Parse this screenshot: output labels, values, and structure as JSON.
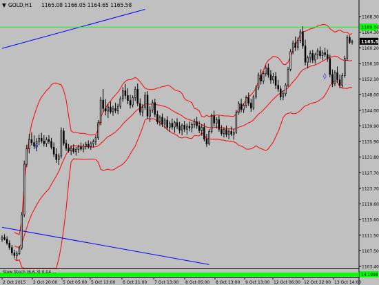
{
  "header": {
    "arrow": "▼",
    "symbol": "GOLD,H1",
    "ohlc": "1165.08 1166.05 1164.65 1165.58"
  },
  "indicator_label": "Slow Stoch (6,6,3) 0.04 ...",
  "colors": {
    "background": "#c0c0c0",
    "candle": "#000000",
    "bollinger": "#ff0000",
    "trendline": "#0000ff",
    "resistance_line": "#00ff00",
    "oscillator": "#00ff00",
    "last_price_label": "#000000",
    "marker": "#0000ff"
  },
  "chart_data": {
    "type": "candlestick",
    "symbol": "GOLD",
    "timeframe": "H1",
    "ylim": [
      1103.4,
      1172.4
    ],
    "ytick_labels": [
      "1168.30",
      "1164.30",
      "1160.20",
      "1156.10",
      "1152.10",
      "1148.00",
      "1144.00",
      "1139.90",
      "1135.90",
      "1131.80",
      "1127.70",
      "1123.70",
      "1119.60",
      "1115.60",
      "1111.50",
      "1107.50",
      "1103.40"
    ],
    "xtick_labels": [
      "2 Oct 2015",
      "2 Oct 20:00",
      "5 Oct 05:00",
      "5 Oct 13:00",
      "6 Oct 21:00",
      "7 Oct 13:00",
      "8 Oct 05:00",
      "8 Oct 13:00",
      "9 Oct 13:00",
      "12 Oct 06:00",
      "12 Oct 22:00",
      "13 Oct 14:00"
    ],
    "resistance_level": 1169.5,
    "resistance_label": "1169.50",
    "last_price": 1165.58,
    "last_price_label": "1165.58",
    "oscillator_label": "Slow Stoch (6,6,3) 0.04 ...",
    "oscillator_value_label": "14.1998",
    "bollinger_period": 20,
    "marker_glyph": "◊",
    "markers": [
      {
        "candle": 14,
        "price": 1136.7
      },
      {
        "candle": 131,
        "price": 1156.0
      }
    ],
    "trendlines": [
      {
        "from": {
          "candle": 0,
          "price": 1163.6
        },
        "to": {
          "candle": 58,
          "price": 1174.4
        }
      },
      {
        "from": {
          "candle": 0,
          "price": 1114.2
        },
        "to": {
          "candle": 84,
          "price": 1103.9
        }
      }
    ],
    "candles": [
      {
        "o": 1110.8,
        "h": 1112.0,
        "l": 1110.2,
        "c": 1111.4
      },
      {
        "o": 1111.4,
        "h": 1112.3,
        "l": 1110.6,
        "c": 1110.9
      },
      {
        "o": 1110.9,
        "h": 1111.7,
        "l": 1109.3,
        "c": 1109.8
      },
      {
        "o": 1109.8,
        "h": 1110.6,
        "l": 1108.0,
        "c": 1108.6
      },
      {
        "o": 1108.6,
        "h": 1109.3,
        "l": 1106.4,
        "c": 1107.1
      },
      {
        "o": 1107.1,
        "h": 1108.0,
        "l": 1105.6,
        "c": 1106.4
      },
      {
        "o": 1106.4,
        "h": 1107.6,
        "l": 1105.2,
        "c": 1106.9
      },
      {
        "o": 1106.9,
        "h": 1109.0,
        "l": 1106.5,
        "c": 1108.5
      },
      {
        "o": 1108.5,
        "h": 1118.4,
        "l": 1108.0,
        "c": 1117.6
      },
      {
        "o": 1117.6,
        "h": 1132.6,
        "l": 1117.0,
        "c": 1131.6
      },
      {
        "o": 1131.6,
        "h": 1137.0,
        "l": 1130.8,
        "c": 1135.9
      },
      {
        "o": 1135.9,
        "h": 1140.0,
        "l": 1134.6,
        "c": 1138.4
      },
      {
        "o": 1138.4,
        "h": 1140.4,
        "l": 1136.8,
        "c": 1137.6
      },
      {
        "o": 1137.6,
        "h": 1139.6,
        "l": 1135.8,
        "c": 1136.6
      },
      {
        "o": 1136.6,
        "h": 1138.8,
        "l": 1135.2,
        "c": 1137.9
      },
      {
        "o": 1137.9,
        "h": 1139.8,
        "l": 1136.9,
        "c": 1138.8
      },
      {
        "o": 1138.8,
        "h": 1140.3,
        "l": 1137.4,
        "c": 1138.0
      },
      {
        "o": 1138.0,
        "h": 1139.6,
        "l": 1136.5,
        "c": 1137.3
      },
      {
        "o": 1137.3,
        "h": 1139.1,
        "l": 1136.4,
        "c": 1138.4
      },
      {
        "o": 1138.4,
        "h": 1139.6,
        "l": 1137.2,
        "c": 1137.9
      },
      {
        "o": 1137.9,
        "h": 1138.9,
        "l": 1135.7,
        "c": 1136.3
      },
      {
        "o": 1136.3,
        "h": 1137.6,
        "l": 1133.6,
        "c": 1134.4
      },
      {
        "o": 1134.4,
        "h": 1136.0,
        "l": 1132.0,
        "c": 1132.9
      },
      {
        "o": 1132.9,
        "h": 1134.6,
        "l": 1131.4,
        "c": 1133.9
      },
      {
        "o": 1133.9,
        "h": 1141.8,
        "l": 1133.2,
        "c": 1140.8
      },
      {
        "o": 1140.8,
        "h": 1141.6,
        "l": 1136.7,
        "c": 1137.4
      },
      {
        "o": 1137.4,
        "h": 1138.4,
        "l": 1135.3,
        "c": 1136.0
      },
      {
        "o": 1136.0,
        "h": 1137.2,
        "l": 1134.8,
        "c": 1135.3
      },
      {
        "o": 1135.3,
        "h": 1136.8,
        "l": 1134.1,
        "c": 1136.0
      },
      {
        "o": 1136.0,
        "h": 1137.1,
        "l": 1134.6,
        "c": 1135.1
      },
      {
        "o": 1135.1,
        "h": 1136.4,
        "l": 1134.0,
        "c": 1135.7
      },
      {
        "o": 1135.7,
        "h": 1137.0,
        "l": 1134.7,
        "c": 1136.4
      },
      {
        "o": 1136.4,
        "h": 1137.6,
        "l": 1135.3,
        "c": 1135.8
      },
      {
        "o": 1135.8,
        "h": 1137.3,
        "l": 1134.9,
        "c": 1136.6
      },
      {
        "o": 1136.6,
        "h": 1137.8,
        "l": 1135.7,
        "c": 1137.1
      },
      {
        "o": 1137.1,
        "h": 1138.2,
        "l": 1135.9,
        "c": 1136.5
      },
      {
        "o": 1136.5,
        "h": 1137.9,
        "l": 1135.6,
        "c": 1137.3
      },
      {
        "o": 1137.3,
        "h": 1138.5,
        "l": 1136.2,
        "c": 1137.8
      },
      {
        "o": 1137.8,
        "h": 1139.6,
        "l": 1136.9,
        "c": 1138.9
      },
      {
        "o": 1138.9,
        "h": 1143.8,
        "l": 1138.3,
        "c": 1143.1
      },
      {
        "o": 1143.1,
        "h": 1150.2,
        "l": 1142.4,
        "c": 1149.3
      },
      {
        "o": 1149.3,
        "h": 1152.4,
        "l": 1146.0,
        "c": 1147.0
      },
      {
        "o": 1147.0,
        "h": 1149.6,
        "l": 1145.1,
        "c": 1146.3
      },
      {
        "o": 1146.3,
        "h": 1148.2,
        "l": 1144.4,
        "c": 1147.4
      },
      {
        "o": 1147.4,
        "h": 1148.9,
        "l": 1145.6,
        "c": 1146.1
      },
      {
        "o": 1146.1,
        "h": 1147.8,
        "l": 1145.0,
        "c": 1147.0
      },
      {
        "o": 1147.0,
        "h": 1148.6,
        "l": 1145.7,
        "c": 1146.4
      },
      {
        "o": 1146.4,
        "h": 1148.3,
        "l": 1145.4,
        "c": 1147.6
      },
      {
        "o": 1147.6,
        "h": 1150.4,
        "l": 1146.9,
        "c": 1149.7
      },
      {
        "o": 1149.7,
        "h": 1152.9,
        "l": 1148.9,
        "c": 1151.9
      },
      {
        "o": 1151.9,
        "h": 1153.8,
        "l": 1149.6,
        "c": 1150.6
      },
      {
        "o": 1150.6,
        "h": 1152.6,
        "l": 1148.2,
        "c": 1149.2
      },
      {
        "o": 1149.2,
        "h": 1150.8,
        "l": 1147.0,
        "c": 1148.0
      },
      {
        "o": 1148.0,
        "h": 1150.6,
        "l": 1147.3,
        "c": 1150.0
      },
      {
        "o": 1150.0,
        "h": 1153.1,
        "l": 1149.1,
        "c": 1152.3
      },
      {
        "o": 1152.3,
        "h": 1153.9,
        "l": 1147.6,
        "c": 1148.4
      },
      {
        "o": 1148.4,
        "h": 1149.8,
        "l": 1145.1,
        "c": 1146.0
      },
      {
        "o": 1146.0,
        "h": 1148.2,
        "l": 1144.8,
        "c": 1147.3
      },
      {
        "o": 1147.3,
        "h": 1151.6,
        "l": 1146.6,
        "c": 1150.7
      },
      {
        "o": 1150.7,
        "h": 1151.8,
        "l": 1144.1,
        "c": 1144.9
      },
      {
        "o": 1144.9,
        "h": 1147.6,
        "l": 1143.3,
        "c": 1146.6
      },
      {
        "o": 1146.6,
        "h": 1149.4,
        "l": 1145.8,
        "c": 1148.6
      },
      {
        "o": 1148.6,
        "h": 1149.7,
        "l": 1144.6,
        "c": 1145.4
      },
      {
        "o": 1145.4,
        "h": 1146.4,
        "l": 1142.6,
        "c": 1143.3
      },
      {
        "o": 1143.3,
        "h": 1145.1,
        "l": 1142.2,
        "c": 1144.6
      },
      {
        "o": 1144.6,
        "h": 1145.6,
        "l": 1141.9,
        "c": 1142.7
      },
      {
        "o": 1142.7,
        "h": 1144.4,
        "l": 1141.5,
        "c": 1143.8
      },
      {
        "o": 1143.8,
        "h": 1144.9,
        "l": 1141.0,
        "c": 1141.8
      },
      {
        "o": 1141.8,
        "h": 1143.5,
        "l": 1140.6,
        "c": 1142.9
      },
      {
        "o": 1142.9,
        "h": 1144.2,
        "l": 1141.2,
        "c": 1141.9
      },
      {
        "o": 1141.9,
        "h": 1143.6,
        "l": 1140.3,
        "c": 1143.1
      },
      {
        "o": 1143.1,
        "h": 1144.3,
        "l": 1141.3,
        "c": 1142.1
      },
      {
        "o": 1142.1,
        "h": 1143.3,
        "l": 1140.1,
        "c": 1141.0
      },
      {
        "o": 1141.0,
        "h": 1142.9,
        "l": 1139.6,
        "c": 1142.4
      },
      {
        "o": 1142.4,
        "h": 1143.6,
        "l": 1140.5,
        "c": 1141.3
      },
      {
        "o": 1141.3,
        "h": 1142.8,
        "l": 1139.8,
        "c": 1142.1
      },
      {
        "o": 1142.1,
        "h": 1143.4,
        "l": 1140.7,
        "c": 1141.6
      },
      {
        "o": 1141.6,
        "h": 1143.2,
        "l": 1140.4,
        "c": 1142.6
      },
      {
        "o": 1142.6,
        "h": 1144.2,
        "l": 1141.6,
        "c": 1143.4
      },
      {
        "o": 1143.4,
        "h": 1144.7,
        "l": 1141.4,
        "c": 1142.2
      },
      {
        "o": 1142.2,
        "h": 1143.5,
        "l": 1140.2,
        "c": 1140.9
      },
      {
        "o": 1140.9,
        "h": 1142.6,
        "l": 1139.5,
        "c": 1141.8
      },
      {
        "o": 1141.8,
        "h": 1143.0,
        "l": 1137.9,
        "c": 1138.6
      },
      {
        "o": 1138.6,
        "h": 1140.0,
        "l": 1136.4,
        "c": 1137.2
      },
      {
        "o": 1137.2,
        "h": 1141.3,
        "l": 1136.8,
        "c": 1140.7
      },
      {
        "o": 1140.7,
        "h": 1145.6,
        "l": 1140.1,
        "c": 1144.9
      },
      {
        "o": 1144.9,
        "h": 1146.4,
        "l": 1142.0,
        "c": 1143.0
      },
      {
        "o": 1143.0,
        "h": 1144.6,
        "l": 1141.5,
        "c": 1143.9
      },
      {
        "o": 1143.9,
        "h": 1145.0,
        "l": 1140.6,
        "c": 1141.3
      },
      {
        "o": 1141.3,
        "h": 1142.4,
        "l": 1139.5,
        "c": 1140.1
      },
      {
        "o": 1140.1,
        "h": 1141.8,
        "l": 1139.0,
        "c": 1141.2
      },
      {
        "o": 1141.2,
        "h": 1142.3,
        "l": 1139.1,
        "c": 1139.8
      },
      {
        "o": 1139.8,
        "h": 1141.3,
        "l": 1138.6,
        "c": 1140.7
      },
      {
        "o": 1140.7,
        "h": 1142.0,
        "l": 1139.4,
        "c": 1139.9
      },
      {
        "o": 1139.9,
        "h": 1141.3,
        "l": 1138.4,
        "c": 1140.5
      },
      {
        "o": 1140.5,
        "h": 1146.6,
        "l": 1140.0,
        "c": 1145.9
      },
      {
        "o": 1145.9,
        "h": 1149.0,
        "l": 1145.3,
        "c": 1148.3
      },
      {
        "o": 1148.3,
        "h": 1149.7,
        "l": 1145.9,
        "c": 1146.7
      },
      {
        "o": 1146.7,
        "h": 1148.4,
        "l": 1145.8,
        "c": 1147.9
      },
      {
        "o": 1147.9,
        "h": 1150.6,
        "l": 1147.2,
        "c": 1150.0
      },
      {
        "o": 1150.0,
        "h": 1151.4,
        "l": 1147.7,
        "c": 1148.5
      },
      {
        "o": 1148.5,
        "h": 1149.6,
        "l": 1146.1,
        "c": 1147.1
      },
      {
        "o": 1147.1,
        "h": 1150.8,
        "l": 1146.6,
        "c": 1150.2
      },
      {
        "o": 1150.2,
        "h": 1153.4,
        "l": 1149.6,
        "c": 1152.7
      },
      {
        "o": 1152.7,
        "h": 1156.9,
        "l": 1152.1,
        "c": 1156.2
      },
      {
        "o": 1156.2,
        "h": 1157.8,
        "l": 1153.6,
        "c": 1154.6
      },
      {
        "o": 1154.6,
        "h": 1157.3,
        "l": 1153.8,
        "c": 1156.7
      },
      {
        "o": 1156.7,
        "h": 1158.9,
        "l": 1155.9,
        "c": 1158.2
      },
      {
        "o": 1158.2,
        "h": 1159.4,
        "l": 1155.5,
        "c": 1156.3
      },
      {
        "o": 1156.3,
        "h": 1157.6,
        "l": 1153.8,
        "c": 1154.9
      },
      {
        "o": 1154.9,
        "h": 1156.8,
        "l": 1153.9,
        "c": 1155.9
      },
      {
        "o": 1155.9,
        "h": 1157.1,
        "l": 1152.4,
        "c": 1153.4
      },
      {
        "o": 1153.4,
        "h": 1154.9,
        "l": 1151.6,
        "c": 1152.4
      },
      {
        "o": 1152.4,
        "h": 1153.3,
        "l": 1149.3,
        "c": 1150.2
      },
      {
        "o": 1150.2,
        "h": 1152.0,
        "l": 1149.3,
        "c": 1151.1
      },
      {
        "o": 1151.1,
        "h": 1154.0,
        "l": 1150.4,
        "c": 1153.5
      },
      {
        "o": 1153.5,
        "h": 1158.5,
        "l": 1153.0,
        "c": 1157.8
      },
      {
        "o": 1157.8,
        "h": 1163.4,
        "l": 1157.3,
        "c": 1162.7
      },
      {
        "o": 1162.7,
        "h": 1165.8,
        "l": 1162.0,
        "c": 1165.1
      },
      {
        "o": 1165.1,
        "h": 1166.9,
        "l": 1162.9,
        "c": 1163.9
      },
      {
        "o": 1163.9,
        "h": 1166.6,
        "l": 1163.1,
        "c": 1165.8
      },
      {
        "o": 1165.8,
        "h": 1168.9,
        "l": 1165.1,
        "c": 1168.2
      },
      {
        "o": 1168.2,
        "h": 1169.7,
        "l": 1163.5,
        "c": 1164.3
      },
      {
        "o": 1164.3,
        "h": 1166.0,
        "l": 1158.9,
        "c": 1159.8
      },
      {
        "o": 1159.8,
        "h": 1161.6,
        "l": 1158.1,
        "c": 1161.0
      },
      {
        "o": 1161.0,
        "h": 1163.0,
        "l": 1159.7,
        "c": 1162.2
      },
      {
        "o": 1162.2,
        "h": 1163.2,
        "l": 1159.6,
        "c": 1160.4
      },
      {
        "o": 1160.4,
        "h": 1162.4,
        "l": 1159.4,
        "c": 1161.8
      },
      {
        "o": 1161.8,
        "h": 1163.6,
        "l": 1160.6,
        "c": 1162.9
      },
      {
        "o": 1162.9,
        "h": 1164.1,
        "l": 1160.8,
        "c": 1161.6
      },
      {
        "o": 1161.6,
        "h": 1163.1,
        "l": 1160.3,
        "c": 1162.4
      },
      {
        "o": 1162.4,
        "h": 1163.8,
        "l": 1161.1,
        "c": 1161.9
      },
      {
        "o": 1161.9,
        "h": 1163.3,
        "l": 1159.9,
        "c": 1160.8
      },
      {
        "o": 1160.8,
        "h": 1161.9,
        "l": 1155.6,
        "c": 1156.4
      },
      {
        "o": 1156.4,
        "h": 1157.8,
        "l": 1152.9,
        "c": 1153.8
      },
      {
        "o": 1153.8,
        "h": 1157.6,
        "l": 1153.2,
        "c": 1156.9
      },
      {
        "o": 1156.9,
        "h": 1158.6,
        "l": 1154.1,
        "c": 1154.9
      },
      {
        "o": 1154.9,
        "h": 1156.4,
        "l": 1152.6,
        "c": 1153.4
      },
      {
        "o": 1153.4,
        "h": 1156.8,
        "l": 1152.8,
        "c": 1156.1
      },
      {
        "o": 1156.1,
        "h": 1161.6,
        "l": 1155.5,
        "c": 1160.9
      },
      {
        "o": 1160.9,
        "h": 1167.3,
        "l": 1160.3,
        "c": 1166.6
      },
      {
        "o": 1166.6,
        "h": 1167.2,
        "l": 1164.8,
        "c": 1165.3
      },
      {
        "o": 1165.3,
        "h": 1166.05,
        "l": 1164.65,
        "c": 1165.58
      }
    ]
  }
}
